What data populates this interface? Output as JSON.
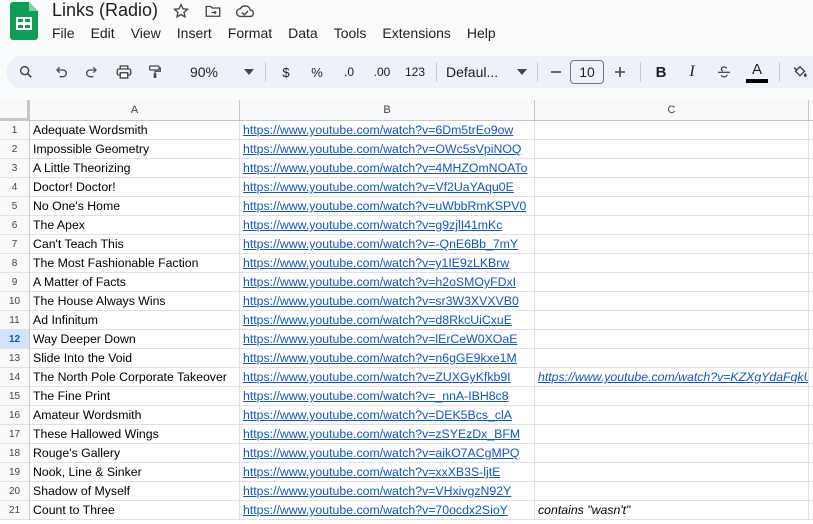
{
  "doc": {
    "title": "Links (Radio)"
  },
  "menu": [
    "File",
    "Edit",
    "View",
    "Insert",
    "Format",
    "Data",
    "Tools",
    "Extensions",
    "Help"
  ],
  "toolbar": {
    "zoom": "90%",
    "currency": "$",
    "percent": "%",
    "dec_decrease": ".0",
    "dec_increase": ".00",
    "number_format": "123",
    "font": "Defaul...",
    "font_size": "10",
    "bold": "B",
    "italic": "I",
    "text_color_letter": "A",
    "text_color": "#000000"
  },
  "columns": [
    "A",
    "B",
    "C"
  ],
  "active_row": 12,
  "rows": [
    {
      "n": "1",
      "a": "Adequate Wordsmith",
      "b": "https://www.youtube.com/watch?v=6Dm5trEo9ow",
      "c": ""
    },
    {
      "n": "2",
      "a": "Impossible Geometry",
      "b": "https://www.youtube.com/watch?v=OWc5sVpiNOQ",
      "c": ""
    },
    {
      "n": "3",
      "a": "A Little Theorizing",
      "b": "https://www.youtube.com/watch?v=4MHZOmNOATo",
      "c": ""
    },
    {
      "n": "4",
      "a": "Doctor! Doctor!",
      "b": "https://www.youtube.com/watch?v=Vf2UaYAqu0E",
      "c": ""
    },
    {
      "n": "5",
      "a": "No One's Home",
      "b": "https://www.youtube.com/watch?v=uWbbRmKSPV0",
      "c": ""
    },
    {
      "n": "6",
      "a": "The Apex",
      "b": "https://www.youtube.com/watch?v=g9zjlI41mKc",
      "c": ""
    },
    {
      "n": "7",
      "a": "Can't Teach This",
      "b": "https://www.youtube.com/watch?v=-QnE6Bb_7mY",
      "c": ""
    },
    {
      "n": "8",
      "a": "The Most Fashionable Faction",
      "b": "https://www.youtube.com/watch?v=y1IE9zLKBrw",
      "c": ""
    },
    {
      "n": "9",
      "a": "A Matter of Facts",
      "b": "https://www.youtube.com/watch?v=h2oSMOyFDxI",
      "c": ""
    },
    {
      "n": "10",
      "a": "The House Always Wins",
      "b": "https://www.youtube.com/watch?v=sr3W3XVXVB0",
      "c": ""
    },
    {
      "n": "11",
      "a": "Ad Infinitum",
      "b": "https://www.youtube.com/watch?v=d8RkcUiCxuE",
      "c": ""
    },
    {
      "n": "12",
      "a": "Way Deeper Down",
      "b": "https://www.youtube.com/watch?v=lErCeW0XOaE",
      "c": ""
    },
    {
      "n": "13",
      "a": "Slide Into the Void",
      "b": "https://www.youtube.com/watch?v=n6gGE9kxe1M",
      "c": ""
    },
    {
      "n": "14",
      "a": "The North Pole Corporate Takeover",
      "b": "https://www.youtube.com/watch?v=ZUXGyKfkb9I",
      "c": "https://www.youtube.com/watch?v=KZXgYdaFqkU",
      "c_type": "link"
    },
    {
      "n": "15",
      "a": "The Fine Print",
      "b": "https://www.youtube.com/watch?v=_nnA-IBH8c8",
      "c": ""
    },
    {
      "n": "16",
      "a": "Amateur Wordsmith",
      "b": "https://www.youtube.com/watch?v=DEK5Bcs_clA",
      "c": ""
    },
    {
      "n": "17",
      "a": "These Hallowed Wings",
      "b": "https://www.youtube.com/watch?v=zSYEzDx_BFM",
      "c": ""
    },
    {
      "n": "18",
      "a": "Rouge's Gallery",
      "b": "https://www.youtube.com/watch?v=aikO7ACgMPQ",
      "c": ""
    },
    {
      "n": "19",
      "a": "Nook, Line & Sinker",
      "b": "https://www.youtube.com/watch?v=xxXB3S-ljtE",
      "c": ""
    },
    {
      "n": "20",
      "a": "Shadow of Myself",
      "b": "https://www.youtube.com/watch?v=VHxivgzN92Y",
      "c": ""
    },
    {
      "n": "21",
      "a": "Count to Three",
      "b": "https://www.youtube.com/watch?v=70ocdx2SioY",
      "c": "contains \"wasn't\"",
      "c_type": "note"
    }
  ]
}
